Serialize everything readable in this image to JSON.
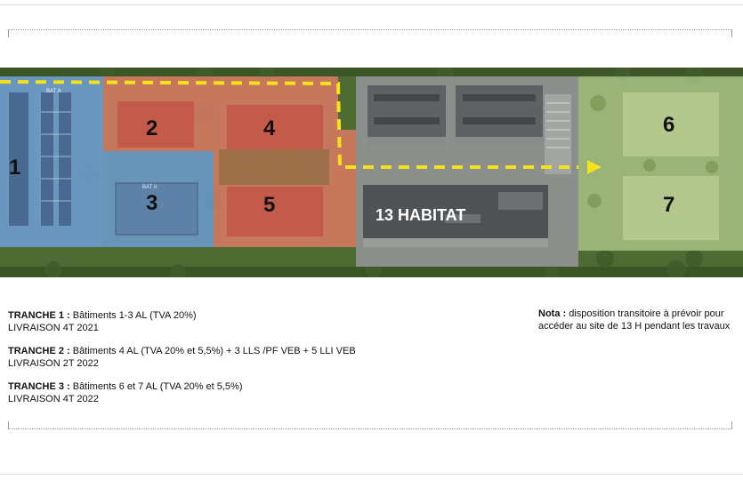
{
  "plan": {
    "lots": [
      {
        "id": "lot-1",
        "label": "1",
        "zone": "blue"
      },
      {
        "id": "lot-2",
        "label": "2",
        "zone": "red"
      },
      {
        "id": "lot-3",
        "label": "3",
        "zone": "blue"
      },
      {
        "id": "lot-4",
        "label": "4",
        "zone": "red"
      },
      {
        "id": "lot-5",
        "label": "5",
        "zone": "red"
      },
      {
        "id": "lot-6",
        "label": "6",
        "zone": "green"
      },
      {
        "id": "lot-7",
        "label": "7",
        "zone": "green"
      }
    ],
    "habitat_label": "13 HABITAT",
    "small_labels": {
      "bat_a_1": "BAT A",
      "bat_a_2": "BAT A"
    },
    "colors": {
      "blue_zone": "#6d9fd8",
      "red_zone": "#e07b67",
      "green_zone": "#cfe3a8",
      "route": "#f4e21c"
    }
  },
  "legend": {
    "t1_title": "TRANCHE 1 :",
    "t1_desc": " Bâtiments 1-3 AL (TVA 20%)",
    "t1_delivery": "LIVRAISON 4T 2021",
    "t2_title": "TRANCHE 2 :",
    "t2_desc": " Bâtiments 4 AL (TVA 20% et 5,5%)  + 3 LLS /PF VEB + 5 LLI VEB",
    "t2_delivery": "LIVRAISON 2T 2022",
    "t3_title": "TRANCHE 3 :",
    "t3_desc": " Bâtiments 6 et 7 AL (TVA 20% et 5,5%)",
    "t3_delivery": "LIVRAISON 4T 2022"
  },
  "nota": {
    "title": "Nota :",
    "text": " disposition transitoire à prévoir pour accéder au site de 13 H pendant les travaux"
  }
}
